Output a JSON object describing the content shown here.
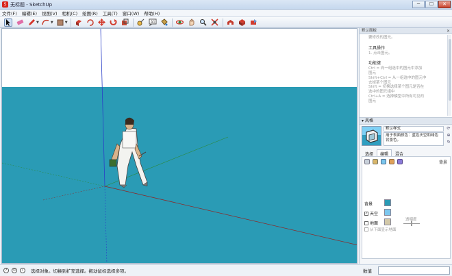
{
  "window": {
    "title": "无标题 - SketchUp",
    "icon": "sketchup-logo-icon",
    "minimize": "─",
    "maximize": "☐",
    "close": "✕"
  },
  "menubar": {
    "items": [
      "文件(F)",
      "编辑(E)",
      "视图(V)",
      "相机(C)",
      "绘图(R)",
      "工具(T)",
      "窗口(W)",
      "帮助(H)"
    ]
  },
  "toolbar": {
    "tools": [
      "select-icon",
      "eraser-icon",
      "pencil-icon",
      "arc-icon",
      "rectangle-icon",
      "push-pull-icon",
      "rotate-icon",
      "move-icon",
      "follow-me-icon",
      "scale-icon",
      "tape-measure-icon",
      "text-icon",
      "paint-bucket-icon",
      "orbit-icon",
      "pan-icon",
      "zoom-icon",
      "zoom-extents-icon",
      "warehouse-icon",
      "extension-icon",
      "share-icon"
    ]
  },
  "viewport": {
    "sky_color": "#ffffff",
    "ground_color": "#2a9bb5",
    "axis_red": "#8a2a2a",
    "axis_green": "#2c8a3a",
    "axis_blue": "#2a3fc7"
  },
  "instructor": {
    "title": "默认面板",
    "intro_line": "要修改的图元。",
    "sections": [
      {
        "heading": "工具操作",
        "lines": [
          "1. 点击图元。"
        ]
      },
      {
        "heading": "功能键",
        "lines": [
          "Ctrl = 向一组选中的图元中添加",
          "图元",
          "Shift+Ctrl = 从一组选中的图元中",
          "去掉某个图元",
          "Shift = 切换选择某个图元是否在",
          "选中的图元组中",
          "Ctrl+A = 选择模型中所有可见的",
          "图元"
        ]
      }
    ]
  },
  "styles": {
    "header": "风格",
    "style_name": "默认样式",
    "style_description": "用于表面颜色：蓝色天空和绿色背景色。",
    "tabs": [
      "选择",
      "编辑",
      "混合"
    ],
    "active_tab": 1,
    "background_label": "背景",
    "rows": {
      "background": "背景",
      "sky": "天空",
      "ground": "地面"
    },
    "background_color": "#2a9bb5",
    "sky_color": "#7cc7ee",
    "ground_color": "#d2c8a8",
    "sky_checked": true,
    "ground_checked": false,
    "opacity_label": "透明度",
    "ground_hint": "从下面显示地面"
  },
  "status": {
    "text": "选择对象。切换到扩充选择。拖动鼠标选择多项。",
    "vcb_label": "数值",
    "vcb_value": ""
  }
}
